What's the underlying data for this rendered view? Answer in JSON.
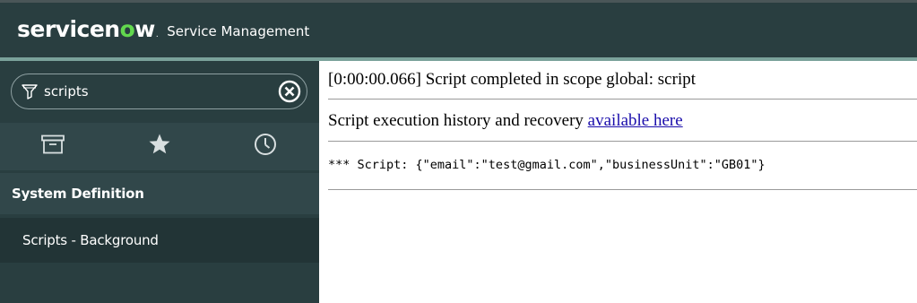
{
  "header": {
    "logo_main": "servicen",
    "logo_o": "o",
    "logo_end": "w",
    "logo_tm": ".",
    "app_title": "Service Management"
  },
  "sidebar": {
    "filter": {
      "value": "scripts"
    },
    "icons": [
      "archive-icon",
      "star-icon",
      "history-icon"
    ],
    "section_title": "System Definition",
    "module_item": "Scripts - Background"
  },
  "content": {
    "result_line": "[0:00:00.066] Script completed in scope global: script",
    "history_text": "Script execution history and recovery ",
    "history_link": "available here",
    "output_line": "*** Script: {\"email\":\"test@gmail.com\",\"businessUnit\":\"GB01\"}"
  },
  "colors": {
    "header_bg": "#293e40",
    "accent": "#7aa29b",
    "logo_green": "#62d84e",
    "link": "#1a0dab"
  }
}
